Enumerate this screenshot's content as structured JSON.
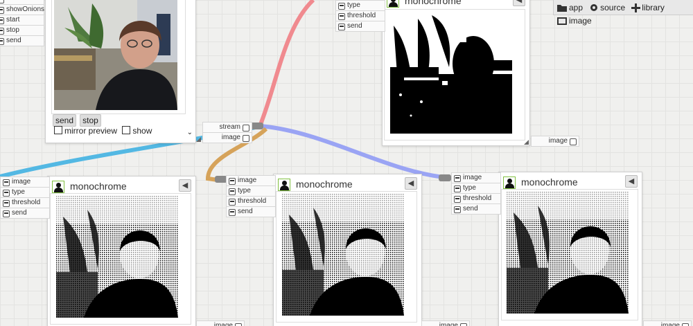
{
  "toolbar": {
    "app": "app",
    "source": "source",
    "library": "library",
    "image": "image"
  },
  "camera": {
    "inputs": [
      "showOnions",
      "start",
      "stop",
      "send"
    ],
    "buttons": {
      "send": "send",
      "stop": "stop"
    },
    "mirror_label": "mirror preview",
    "show_label": "show",
    "outputs": [
      "stream",
      "image"
    ]
  },
  "threshold_node": {
    "inputs": [
      "type",
      "threshold",
      "send"
    ],
    "title": "monochrome",
    "output": "image"
  },
  "nodes": [
    {
      "title": "monochrome",
      "inputs": [
        "image",
        "type",
        "threshold",
        "send"
      ],
      "output": "image"
    },
    {
      "title": "monochrome",
      "inputs": [
        "image",
        "type",
        "threshold",
        "send"
      ],
      "output": "image"
    },
    {
      "title": "monochrome",
      "inputs": [
        "image",
        "type",
        "threshold",
        "send"
      ],
      "output": "image"
    }
  ],
  "colors": {
    "wire_pink": "#f08a8f",
    "wire_blue": "#9aa4f4",
    "wire_orange": "#d6a35a",
    "wire_cyan": "#53b8e3"
  }
}
